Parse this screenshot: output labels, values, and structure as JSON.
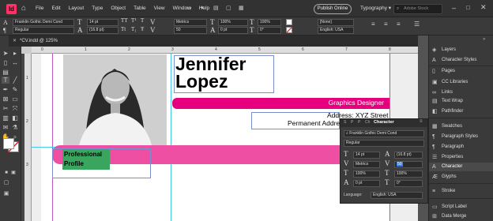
{
  "app": {
    "logo": "Id",
    "home_icon": "home-icon"
  },
  "menu": [
    "File",
    "Edit",
    "Layout",
    "Type",
    "Object",
    "Table",
    "View",
    "Window",
    "Help"
  ],
  "publish_label": "Publish Online",
  "typography_label": "Typography",
  "search_placeholder": "Adobe Stock",
  "control": {
    "font_family": "Franklin Gothic Demi Cond",
    "font_style": "Regular",
    "font_size": "14 pt",
    "leading": "(16.8 pt)",
    "kerning": "Metrics",
    "tracking": "50",
    "vscale": "100%",
    "hscale": "100%",
    "baseline": "0 pt",
    "skew": "0°",
    "char_style": "[None]",
    "language": "English: USA"
  },
  "doc_tab": "*CV.indd @ 125%",
  "ruler_top_labels": [
    "0",
    "1",
    "2",
    "3",
    "4",
    "5",
    "6",
    "7",
    "8"
  ],
  "ruler_left_labels": [
    "1",
    "2",
    "3"
  ],
  "document": {
    "first_name": "Jennifer",
    "last_name": "Lopez",
    "title": "Graphics Designer",
    "address_line1": "Address: XYZ Street",
    "address_line2": "Permanent Addre",
    "profile_line1": "Professional",
    "profile_line2": "Profile"
  },
  "char_panel": {
    "tabs": [
      "S",
      "P",
      "P",
      "Ch"
    ],
    "title": "Character",
    "font_family": "Franklin Gothic Demi Cond",
    "font_style": "Regular",
    "font_size": "14 pt",
    "leading": "(16.8 pt)",
    "kerning": "Metrics",
    "tracking": "50",
    "vscale": "100%",
    "hscale": "100%",
    "baseline": "0 pt",
    "skew": "0°",
    "language_label": "Language:",
    "language": "English: USA"
  },
  "panels": [
    {
      "label": "Layers",
      "icon": "layers-icon"
    },
    {
      "label": "Character Styles",
      "icon": "character-styles-icon"
    },
    {
      "label": "Pages",
      "icon": "pages-icon"
    },
    {
      "label": "CC Libraries",
      "icon": "cc-libraries-icon"
    },
    {
      "label": "Links",
      "icon": "links-icon"
    },
    {
      "label": "Text Wrap",
      "icon": "text-wrap-icon"
    },
    {
      "label": "Pathfinder",
      "icon": "pathfinder-icon"
    },
    {
      "label": "Swatches",
      "icon": "swatches-icon"
    },
    {
      "label": "Paragraph Styles",
      "icon": "paragraph-styles-icon"
    },
    {
      "label": "Paragraph",
      "icon": "paragraph-icon"
    },
    {
      "label": "Properties",
      "icon": "properties-icon"
    },
    {
      "label": "Character",
      "icon": "character-icon"
    },
    {
      "label": "Glyphs",
      "icon": "glyphs-icon"
    },
    {
      "label": "Stroke",
      "icon": "stroke-icon"
    },
    {
      "label": "Script Label",
      "icon": "script-label-icon"
    },
    {
      "label": "Data Merge",
      "icon": "data-merge-icon"
    }
  ],
  "colors": {
    "accent_pink": "#e6007e",
    "band_pink": "#ee4fa3",
    "profile_green": "#3aa55f",
    "guide": "#44c8e6"
  }
}
